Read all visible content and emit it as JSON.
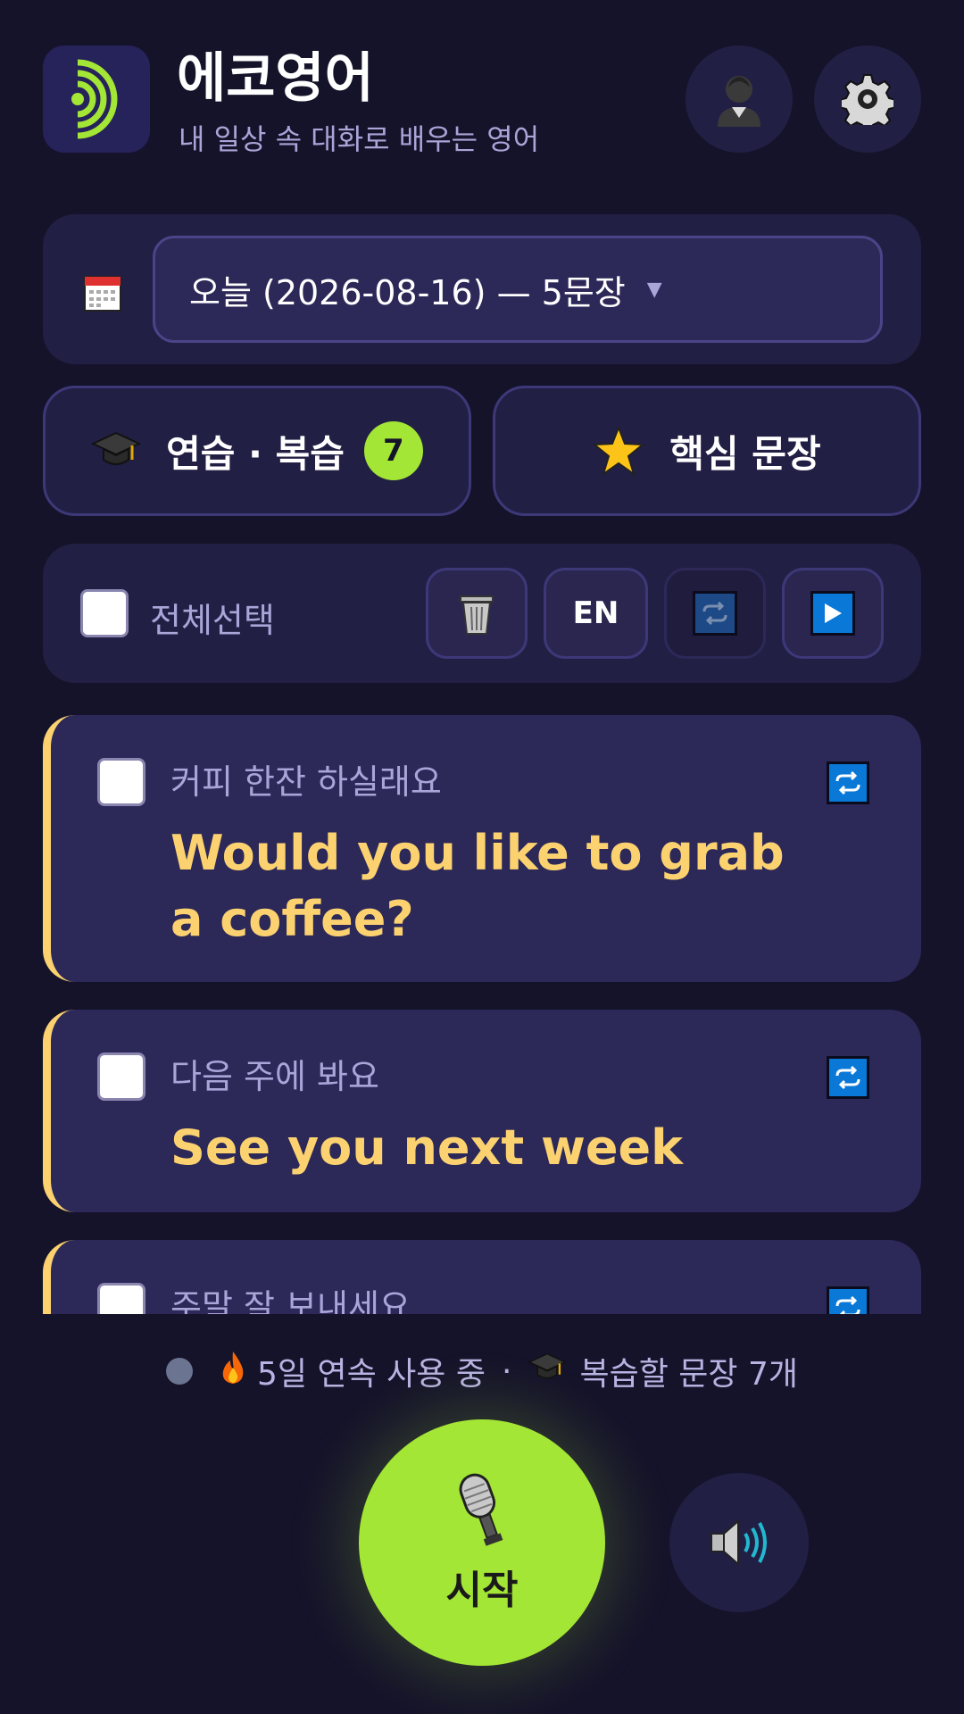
{
  "header": {
    "title": "에코영어",
    "subtitle": "내 일상 속 대화로 배우는 영어",
    "logo_icon": "sound-waves-icon",
    "profile_icon": "person-icon",
    "settings_icon": "gear-icon"
  },
  "date_picker": {
    "icon": "calendar-icon",
    "selected": "오늘 (2026-08-16) — 5문장"
  },
  "actions": {
    "practice_label": "연습 · 복습",
    "practice_count": "7",
    "key_sentences_label": "핵심 문장"
  },
  "toolbar": {
    "select_all_label": "전체선택",
    "language_toggle": "EN",
    "delete_icon": "trash-icon",
    "repeat_icon": "repeat-icon",
    "play_icon": "play-icon"
  },
  "sentences": [
    {
      "ko": "커피 한잔 하실래요",
      "en": "Would you like to grab a coffee?"
    },
    {
      "ko": "다음 주에 봐요",
      "en": "See you next week"
    },
    {
      "ko": "주말 잘 보내세요",
      "en": ""
    }
  ],
  "status": {
    "streak": "5일 연속 사용 중",
    "separator": "·",
    "review": "복습할 문장 7개"
  },
  "controls": {
    "mic_label": "시작",
    "speaker_icon": "speaker-icon"
  },
  "colors": {
    "background": "#15132a",
    "accent_green": "#a3e635",
    "accent_yellow": "#fcd270",
    "card": "#2c2858"
  }
}
